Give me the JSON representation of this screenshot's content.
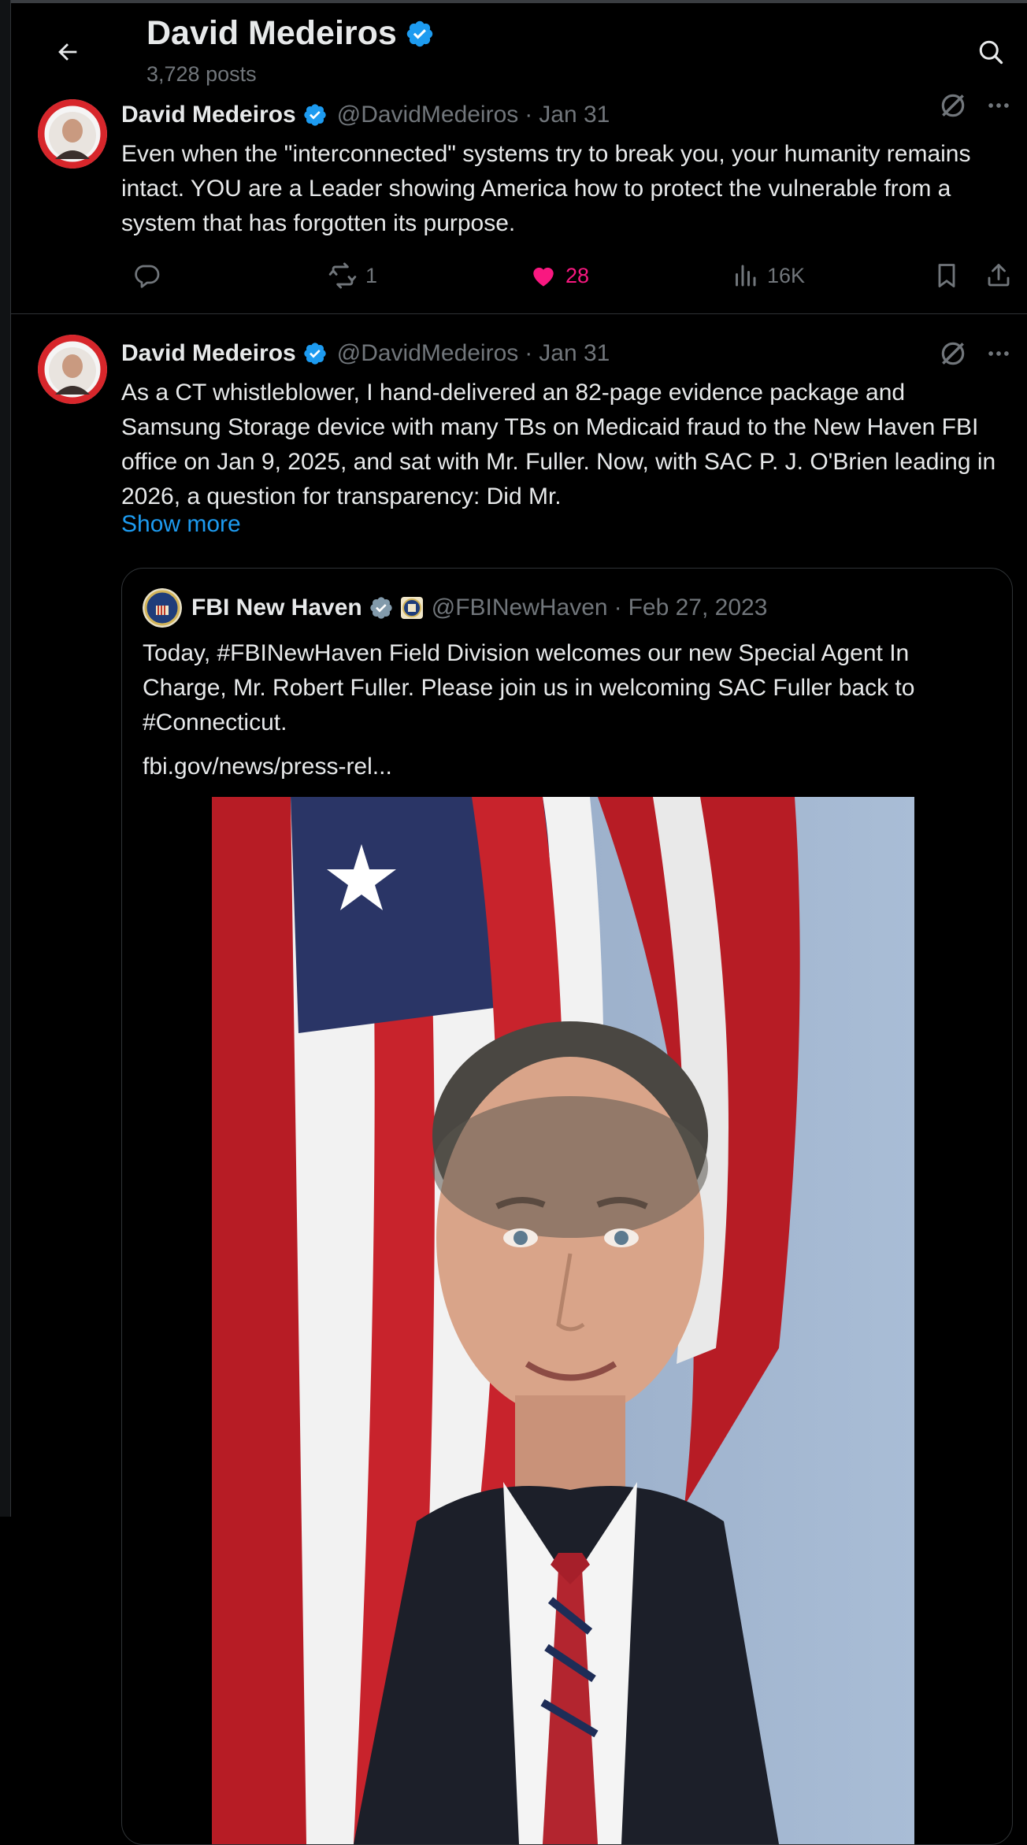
{
  "header": {
    "title": "David Medeiros",
    "posts_count": "3,728 posts"
  },
  "tweets": [
    {
      "name": "David Medeiros",
      "handle": "@DavidMedeiros",
      "separator": "·",
      "date": "Jan 31",
      "text": "Even when the \"interconnected\" systems try to break you, your humanity remains intact. YOU are a Leader showing America how to protect the vulnerable from a system that has forgotten its purpose.",
      "stats": {
        "replies": "",
        "reposts": "1",
        "likes": "28",
        "views": "16K"
      }
    },
    {
      "name": "David Medeiros",
      "handle": "@DavidMedeiros",
      "separator": "·",
      "date": "Jan 31",
      "text": "As a CT whistleblower, I hand-delivered an 82-page evidence package and Samsung Storage device with many TBs on Medicaid fraud to the New Haven FBI office on Jan 9, 2025, and sat with Mr. Fuller. Now, with SAC P. J. O'Brien leading in 2026, a question for transparency: Did Mr.",
      "show_more": "Show more",
      "quote": {
        "name": "FBI New Haven",
        "handle": "@FBINewHaven",
        "separator": "·",
        "date": "Feb 27, 2023",
        "text": "Today, #FBINewHaven Field Division welcomes our new Special Agent In Charge, Mr. Robert Fuller.  Please join us in welcoming SAC Fuller back to #Connecticut.",
        "link": "fbi.gov/news/press-rel..."
      }
    }
  ],
  "colors": {
    "background": "#000000",
    "text": "#e7e9ea",
    "muted": "#71767b",
    "accent": "#1d9bf0",
    "like": "#f91880",
    "border": "#2f3336"
  },
  "icons": [
    "back-arrow-icon",
    "search-icon",
    "verified-badge-icon",
    "grok-icon",
    "more-icon",
    "reply-icon",
    "repost-icon",
    "like-icon",
    "views-icon",
    "bookmark-icon",
    "share-icon",
    "fbi-seal-icon"
  ]
}
